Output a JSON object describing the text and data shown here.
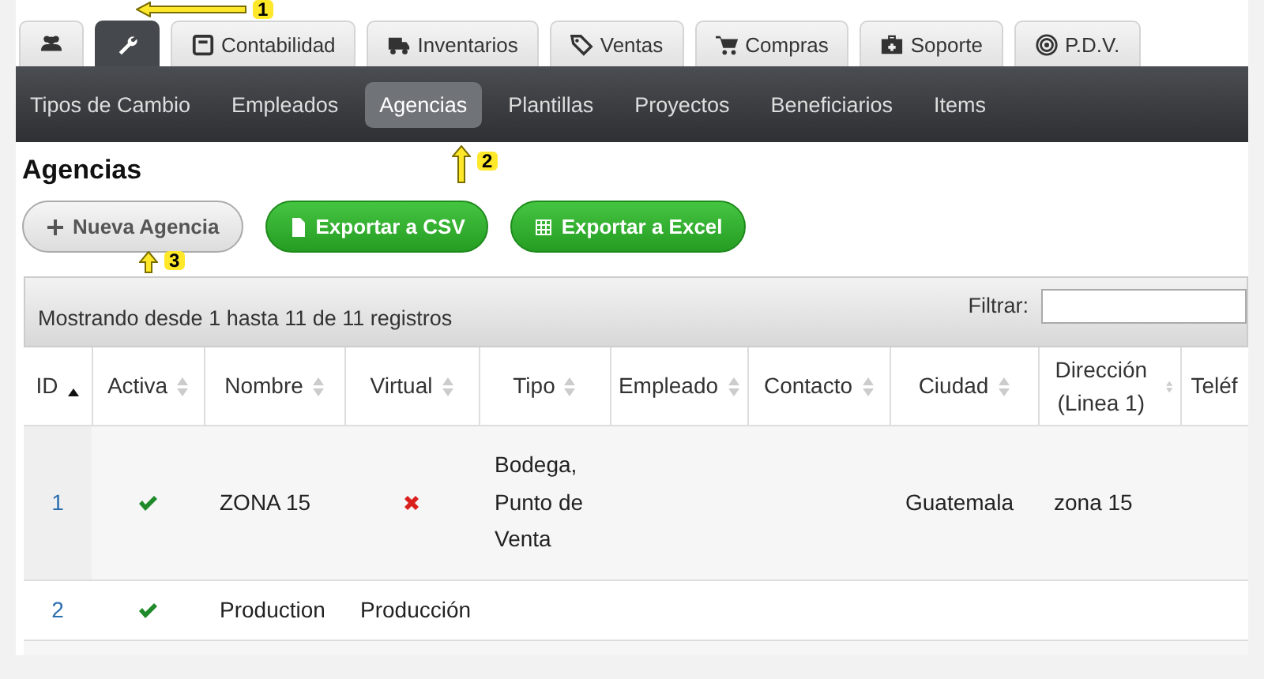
{
  "tabs": [
    {
      "kind": "users",
      "selected": false
    },
    {
      "kind": "wrench",
      "selected": true
    },
    {
      "kind": "calculator",
      "label": "Contabilidad",
      "selected": false
    },
    {
      "kind": "truck",
      "label": "Inventarios",
      "selected": false
    },
    {
      "kind": "tags",
      "label": "Ventas",
      "selected": false
    },
    {
      "kind": "cart",
      "label": "Compras",
      "selected": false
    },
    {
      "kind": "medkit",
      "label": "Soporte",
      "selected": false
    },
    {
      "kind": "target",
      "label": "P.D.V.",
      "selected": false
    }
  ],
  "subnav": [
    {
      "label": "Tipos de Cambio",
      "selected": false
    },
    {
      "label": "Empleados",
      "selected": false
    },
    {
      "label": "Agencias",
      "selected": true
    },
    {
      "label": "Plantillas",
      "selected": false
    },
    {
      "label": "Proyectos",
      "selected": false
    },
    {
      "label": "Beneficiarios",
      "selected": false
    },
    {
      "label": "Items",
      "selected": false
    }
  ],
  "page_title": "Agencias",
  "buttons": [
    {
      "kind": "plus",
      "label": "Nueva Agencia"
    },
    {
      "kind": "file",
      "label": "Exportar a CSV"
    },
    {
      "kind": "grid",
      "label": "Exportar a Excel"
    }
  ],
  "table": {
    "info": "Mostrando desde 1 hasta 11 de 11 registros",
    "filter_label": "Filtrar:",
    "columns": [
      {
        "label": "ID",
        "sorted": true
      },
      {
        "label": "Activa",
        "sorted": false
      },
      {
        "label": "Nombre",
        "sorted": false
      },
      {
        "label": "Virtual",
        "sorted": false
      },
      {
        "label": "Tipo",
        "sorted": false
      },
      {
        "label": "Empleado",
        "sorted": false
      },
      {
        "label": "Contacto",
        "sorted": false
      },
      {
        "label": "Ciudad",
        "sorted": false
      },
      {
        "label": "Dirección (Linea 1)",
        "sorted": false
      },
      {
        "label": "Teléf"
      }
    ],
    "rows": [
      {
        "cells": [
          {
            "kind": "link",
            "text": "1"
          },
          {
            "kind": "yes"
          },
          {
            "kind": "text",
            "text": "ZONA 15"
          },
          {
            "kind": "no"
          },
          {
            "kind": "text",
            "text": "Bodega, Punto de Venta"
          },
          {
            "kind": "empty"
          },
          {
            "kind": "empty"
          },
          {
            "kind": "text",
            "text": "Guatemala"
          },
          {
            "kind": "text",
            "text": "zona 15"
          },
          {
            "kind": "empty"
          }
        ]
      },
      {
        "cells": [
          {
            "kind": "link",
            "text": "2"
          },
          {
            "kind": "yes"
          },
          {
            "kind": "text",
            "text": "Production"
          },
          {
            "kind": "text",
            "text": "Producción"
          },
          {
            "kind": "empty"
          },
          {
            "kind": "empty"
          },
          {
            "kind": "empty"
          },
          {
            "kind": "empty"
          },
          {
            "kind": "empty"
          },
          {
            "kind": "empty"
          }
        ]
      }
    ]
  },
  "callouts": [
    {
      "number": "1"
    },
    {
      "number": "2"
    },
    {
      "number": "3"
    }
  ]
}
